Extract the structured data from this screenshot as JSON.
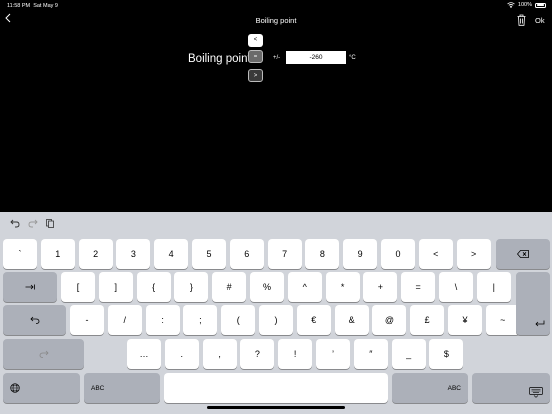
{
  "status_bar": {
    "time": "11:58 PM",
    "date": "Sat May 9",
    "battery_text": "100%"
  },
  "nav": {
    "back_icon": "chevron-left-icon",
    "title": "Boiling point",
    "done_label": "Ok",
    "trash_icon": "trash-icon"
  },
  "editor": {
    "label": "Boiling point",
    "step_up": "<",
    "step_mid": "=",
    "step_down": ">",
    "plus_minus": "+/-",
    "value": "-260",
    "unit": "°C"
  },
  "keyboard": {
    "row1": [
      "`",
      "1",
      "2",
      "3",
      "4",
      "5",
      "6",
      "7",
      "8",
      "9",
      "0",
      "<",
      ">"
    ],
    "row2": [
      "[",
      "]",
      "{",
      "}",
      "#",
      "%",
      "^",
      "*",
      "+",
      "=",
      "\\",
      "|"
    ],
    "row3": [
      "-",
      "/",
      ":",
      ";",
      "(",
      ")",
      "€",
      "&",
      "@",
      "£",
      "¥",
      "~"
    ],
    "row4": [
      "…",
      ".",
      ",",
      "?",
      "!",
      "’",
      "″",
      "_",
      "$"
    ],
    "abc_label": "ABC",
    "colors": {
      "background": "#d1d4da",
      "key": "#ffffff",
      "dark_key": "#acb0b9"
    }
  }
}
